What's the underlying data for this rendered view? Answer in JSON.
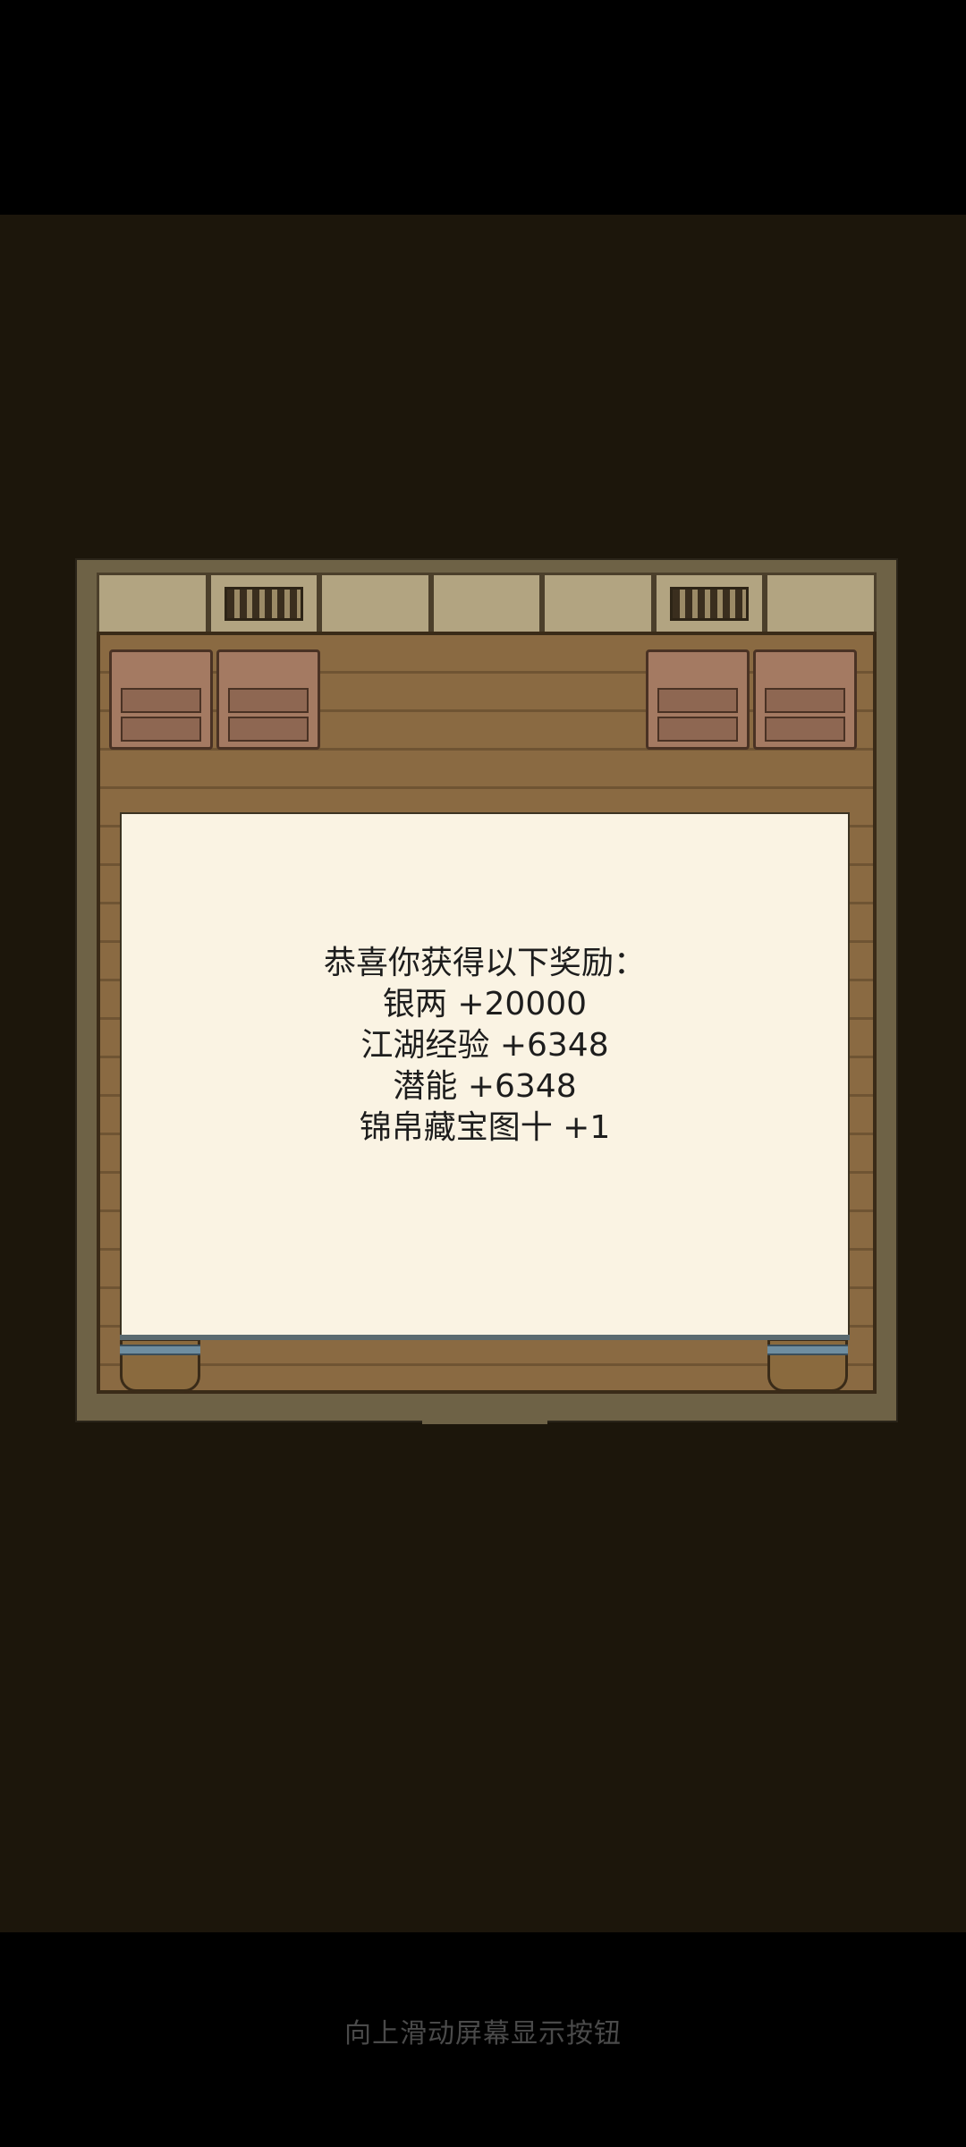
{
  "dialog": {
    "title": "恭喜你获得以下奖励：",
    "rewards": [
      "银两 +20000",
      "江湖经验 +6348",
      "潜能 +6348",
      "锦帛藏宝图十 +1"
    ]
  },
  "system": {
    "gesture_hint": "向上滑动屏幕显示按钮"
  },
  "colors": {
    "background": "#1c160b",
    "dialog_bg": "#faf3e3",
    "text": "#1d1d1d"
  }
}
